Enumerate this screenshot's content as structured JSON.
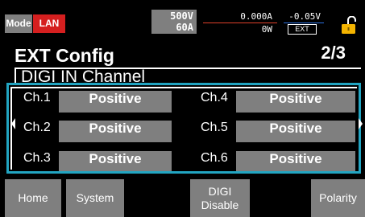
{
  "status": {
    "mode_label": "Mode",
    "interface_label": "LAN",
    "voltage_rating": "500V",
    "current_rating": "60A",
    "current_reading": "0.000A",
    "voltage_reading": "-0.05V",
    "power_reading": "0W",
    "control_source": "EXT",
    "lock_icon": "lock-open-icon"
  },
  "screen": {
    "title": "EXT Config",
    "page": "2/3",
    "section": "DIGI IN Channel"
  },
  "channels": [
    {
      "label": "Ch.1",
      "value": "Positive"
    },
    {
      "label": "Ch.2",
      "value": "Positive"
    },
    {
      "label": "Ch.3",
      "value": "Positive"
    },
    {
      "label": "Ch.4",
      "value": "Positive"
    },
    {
      "label": "Ch.5",
      "value": "Positive"
    },
    {
      "label": "Ch.6",
      "value": "Positive"
    }
  ],
  "softkeys": {
    "home": "Home",
    "system": "System",
    "digi_line1": "DIGI",
    "digi_line2": "Disable",
    "polarity": "Polarity"
  },
  "colors": {
    "lan_red": "#d51f1f",
    "focus_cyan": "#22a5c2",
    "button_gray": "#7f7f7f",
    "lock_yellow": "#f4b400",
    "current_underline": "#e0402a",
    "voltage_underline": "#2a6fe0"
  }
}
